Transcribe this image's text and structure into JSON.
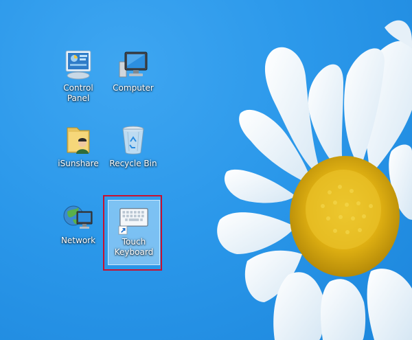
{
  "desktop": {
    "icons": [
      {
        "label": "Control\nPanel",
        "icon": "control-panel-icon"
      },
      {
        "label": "Computer",
        "icon": "computer-icon"
      },
      {
        "label": "iSunshare",
        "icon": "user-folder-icon"
      },
      {
        "label": "Recycle Bin",
        "icon": "recycle-bin-icon"
      },
      {
        "label": "Network",
        "icon": "network-icon"
      },
      {
        "label": "Touch\nKeyboard",
        "icon": "touch-keyboard-icon",
        "selected": true,
        "shortcut": true
      }
    ]
  },
  "colors": {
    "wallpaper": "#2b98ea",
    "highlight": "#c8102e",
    "flower_center": "#e0b414",
    "petal": "#ffffff"
  }
}
